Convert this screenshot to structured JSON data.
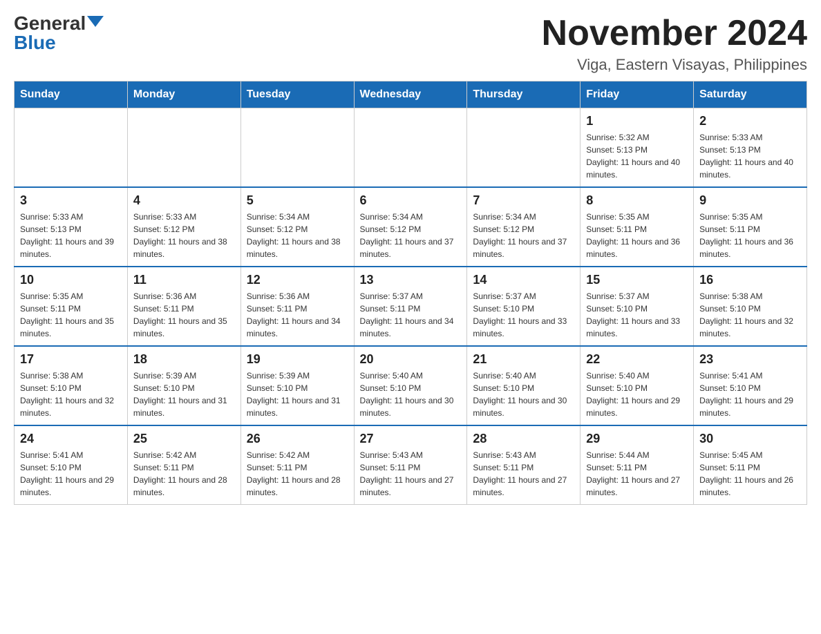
{
  "logo": {
    "general": "General",
    "blue": "Blue"
  },
  "title": "November 2024",
  "location": "Viga, Eastern Visayas, Philippines",
  "weekdays": [
    "Sunday",
    "Monday",
    "Tuesday",
    "Wednesday",
    "Thursday",
    "Friday",
    "Saturday"
  ],
  "weeks": [
    [
      {
        "day": "",
        "info": ""
      },
      {
        "day": "",
        "info": ""
      },
      {
        "day": "",
        "info": ""
      },
      {
        "day": "",
        "info": ""
      },
      {
        "day": "",
        "info": ""
      },
      {
        "day": "1",
        "info": "Sunrise: 5:32 AM\nSunset: 5:13 PM\nDaylight: 11 hours and 40 minutes."
      },
      {
        "day": "2",
        "info": "Sunrise: 5:33 AM\nSunset: 5:13 PM\nDaylight: 11 hours and 40 minutes."
      }
    ],
    [
      {
        "day": "3",
        "info": "Sunrise: 5:33 AM\nSunset: 5:13 PM\nDaylight: 11 hours and 39 minutes."
      },
      {
        "day": "4",
        "info": "Sunrise: 5:33 AM\nSunset: 5:12 PM\nDaylight: 11 hours and 38 minutes."
      },
      {
        "day": "5",
        "info": "Sunrise: 5:34 AM\nSunset: 5:12 PM\nDaylight: 11 hours and 38 minutes."
      },
      {
        "day": "6",
        "info": "Sunrise: 5:34 AM\nSunset: 5:12 PM\nDaylight: 11 hours and 37 minutes."
      },
      {
        "day": "7",
        "info": "Sunrise: 5:34 AM\nSunset: 5:12 PM\nDaylight: 11 hours and 37 minutes."
      },
      {
        "day": "8",
        "info": "Sunrise: 5:35 AM\nSunset: 5:11 PM\nDaylight: 11 hours and 36 minutes."
      },
      {
        "day": "9",
        "info": "Sunrise: 5:35 AM\nSunset: 5:11 PM\nDaylight: 11 hours and 36 minutes."
      }
    ],
    [
      {
        "day": "10",
        "info": "Sunrise: 5:35 AM\nSunset: 5:11 PM\nDaylight: 11 hours and 35 minutes."
      },
      {
        "day": "11",
        "info": "Sunrise: 5:36 AM\nSunset: 5:11 PM\nDaylight: 11 hours and 35 minutes."
      },
      {
        "day": "12",
        "info": "Sunrise: 5:36 AM\nSunset: 5:11 PM\nDaylight: 11 hours and 34 minutes."
      },
      {
        "day": "13",
        "info": "Sunrise: 5:37 AM\nSunset: 5:11 PM\nDaylight: 11 hours and 34 minutes."
      },
      {
        "day": "14",
        "info": "Sunrise: 5:37 AM\nSunset: 5:10 PM\nDaylight: 11 hours and 33 minutes."
      },
      {
        "day": "15",
        "info": "Sunrise: 5:37 AM\nSunset: 5:10 PM\nDaylight: 11 hours and 33 minutes."
      },
      {
        "day": "16",
        "info": "Sunrise: 5:38 AM\nSunset: 5:10 PM\nDaylight: 11 hours and 32 minutes."
      }
    ],
    [
      {
        "day": "17",
        "info": "Sunrise: 5:38 AM\nSunset: 5:10 PM\nDaylight: 11 hours and 32 minutes."
      },
      {
        "day": "18",
        "info": "Sunrise: 5:39 AM\nSunset: 5:10 PM\nDaylight: 11 hours and 31 minutes."
      },
      {
        "day": "19",
        "info": "Sunrise: 5:39 AM\nSunset: 5:10 PM\nDaylight: 11 hours and 31 minutes."
      },
      {
        "day": "20",
        "info": "Sunrise: 5:40 AM\nSunset: 5:10 PM\nDaylight: 11 hours and 30 minutes."
      },
      {
        "day": "21",
        "info": "Sunrise: 5:40 AM\nSunset: 5:10 PM\nDaylight: 11 hours and 30 minutes."
      },
      {
        "day": "22",
        "info": "Sunrise: 5:40 AM\nSunset: 5:10 PM\nDaylight: 11 hours and 29 minutes."
      },
      {
        "day": "23",
        "info": "Sunrise: 5:41 AM\nSunset: 5:10 PM\nDaylight: 11 hours and 29 minutes."
      }
    ],
    [
      {
        "day": "24",
        "info": "Sunrise: 5:41 AM\nSunset: 5:10 PM\nDaylight: 11 hours and 29 minutes."
      },
      {
        "day": "25",
        "info": "Sunrise: 5:42 AM\nSunset: 5:11 PM\nDaylight: 11 hours and 28 minutes."
      },
      {
        "day": "26",
        "info": "Sunrise: 5:42 AM\nSunset: 5:11 PM\nDaylight: 11 hours and 28 minutes."
      },
      {
        "day": "27",
        "info": "Sunrise: 5:43 AM\nSunset: 5:11 PM\nDaylight: 11 hours and 27 minutes."
      },
      {
        "day": "28",
        "info": "Sunrise: 5:43 AM\nSunset: 5:11 PM\nDaylight: 11 hours and 27 minutes."
      },
      {
        "day": "29",
        "info": "Sunrise: 5:44 AM\nSunset: 5:11 PM\nDaylight: 11 hours and 27 minutes."
      },
      {
        "day": "30",
        "info": "Sunrise: 5:45 AM\nSunset: 5:11 PM\nDaylight: 11 hours and 26 minutes."
      }
    ]
  ]
}
